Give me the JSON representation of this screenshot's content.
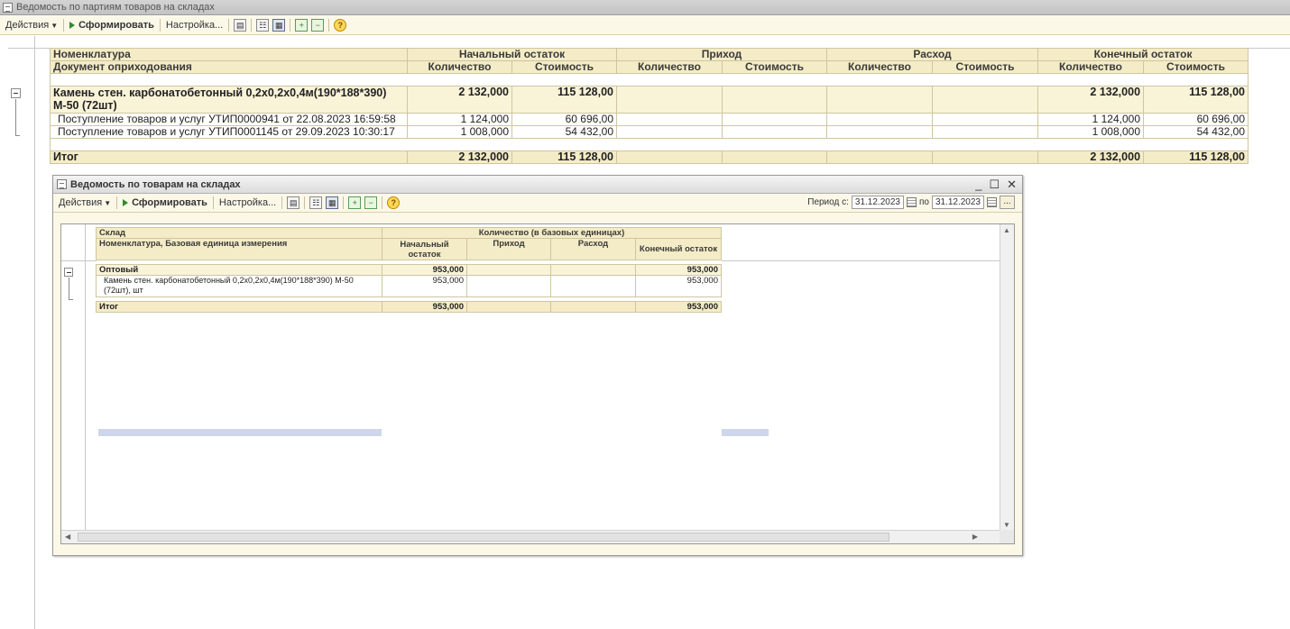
{
  "window": {
    "title": "Ведомость по партиям товаров на складах"
  },
  "toolbar": {
    "actions_label": "Действия",
    "generate_label": "Сформировать",
    "settings_label": "Настройка..."
  },
  "report": {
    "header_row1": {
      "nomenclature": "Номенклатура",
      "opening": "Начальный остаток",
      "income": "Приход",
      "expense": "Расход",
      "closing": "Конечный остаток"
    },
    "header_row2": {
      "document": "Документ оприходования",
      "qty": "Количество",
      "cost": "Стоимость"
    },
    "group": {
      "name": "Камень стен. карбонатобетонный 0,2x0,2x0,4м(190*188*390) М-50 (72шт)",
      "open_qty": "2 132,000",
      "open_cost": "115 128,00",
      "close_qty": "2 132,000",
      "close_cost": "115 128,00"
    },
    "items": [
      {
        "doc": "Поступление товаров и услуг УТИП0000941 от 22.08.2023 16:59:58",
        "open_qty": "1 124,000",
        "open_cost": "60 696,00",
        "close_qty": "1 124,000",
        "close_cost": "60 696,00"
      },
      {
        "doc": "Поступление товаров и услуг УТИП0001145 от 29.09.2023 10:30:17",
        "open_qty": "1 008,000",
        "open_cost": "54 432,00",
        "close_qty": "1 008,000",
        "close_cost": "54 432,00"
      }
    ],
    "total": {
      "label": "Итог",
      "open_qty": "2 132,000",
      "open_cost": "115 128,00",
      "close_qty": "2 132,000",
      "close_cost": "115 128,00"
    }
  },
  "inner_window": {
    "title": "Ведомость по товарам на складах",
    "toolbar": {
      "actions_label": "Действия",
      "generate_label": "Сформировать",
      "settings_label": "Настройка...",
      "period_from_label": "Период с:",
      "period_from": "31.12.2023",
      "period_to_label": "по",
      "period_to": "31.12.2023",
      "more_label": "..."
    },
    "report": {
      "header": {
        "warehouse": "Склад",
        "nomenclature_unit": "Номенклатура, Базовая единица измерения",
        "qty_group": "Количество (в базовых единицах)",
        "opening": "Начальный остаток",
        "income": "Приход",
        "expense": "Расход",
        "closing": "Конечный остаток"
      },
      "group": {
        "name": "Оптовый",
        "opening": "953,000",
        "closing": "953,000"
      },
      "item": {
        "name": "Камень стен. карбонатобетонный 0,2x0,2x0,4м(190*188*390) М-50 (72шт), шт",
        "opening": "953,000",
        "closing": "953,000"
      },
      "total": {
        "label": "Итог",
        "opening": "953,000",
        "closing": "953,000"
      }
    }
  }
}
